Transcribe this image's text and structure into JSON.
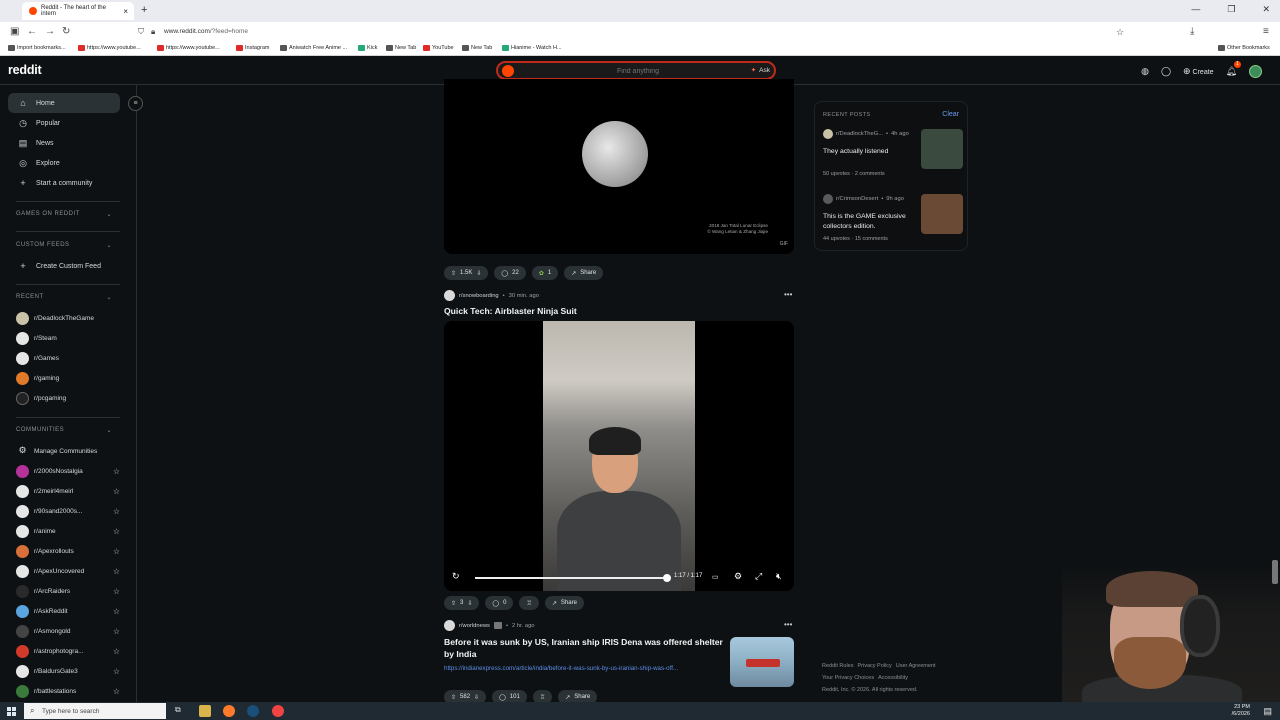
{
  "browser": {
    "tab_title": "Reddit - The heart of the intern",
    "tab_close": "×",
    "new_tab": "+",
    "url_host": "www.reddit.com",
    "url_path": "/?feed=home",
    "win_min": "—",
    "win_max": "❐",
    "win_close": "✕",
    "bookmarks": [
      "Import bookmarks...",
      "https://www.youtube...",
      "https://www.youtube...",
      "Instagram",
      "Aniwatch Free Anime ...",
      "Kick",
      "New Tab",
      "YouTube",
      "New Tab",
      "Hianime - Watch H..."
    ],
    "other_bookmarks": "Other Bookmarks"
  },
  "header": {
    "logo": "reddit",
    "search_placeholder": "Find anything",
    "ask_label": "Ask",
    "create_label": "Create",
    "notif_count": "1"
  },
  "sidebar": {
    "main": [
      {
        "label": "Home",
        "icon": "⌂"
      },
      {
        "label": "Popular",
        "icon": "◷"
      },
      {
        "label": "News",
        "icon": "▤"
      },
      {
        "label": "Explore",
        "icon": "◎"
      },
      {
        "label": "Start a community",
        "icon": "+"
      }
    ],
    "games_heading": "GAMES ON REDDIT",
    "custom_heading": "CUSTOM FEEDS",
    "create_custom_feed": "Create Custom Feed",
    "recent_heading": "RECENT",
    "recent": [
      {
        "name": "r/DeadlockTheGame",
        "color": "#c8c2a6"
      },
      {
        "name": "r/Steam",
        "color": "#e6e6e6"
      },
      {
        "name": "r/Games",
        "color": "#e6e6e6"
      },
      {
        "name": "r/gaming",
        "color": "#e07a2b"
      },
      {
        "name": "r/pcgaming",
        "color": "#222222"
      }
    ],
    "communities_heading": "COMMUNITIES",
    "manage_communities": "Manage Communities",
    "communities": [
      {
        "name": "r/2000sNostalgia",
        "color": "#b5329b"
      },
      {
        "name": "r/2meirl4meirl",
        "color": "#e6e6e6"
      },
      {
        "name": "r/90sand2000s...",
        "color": "#e6e6e6"
      },
      {
        "name": "r/anime",
        "color": "#e6e6e6"
      },
      {
        "name": "r/Apexrollouts",
        "color": "#d9703a"
      },
      {
        "name": "r/ApexUncovered",
        "color": "#e6e6e6"
      },
      {
        "name": "r/ArcRaiders",
        "color": "#2a2a2a"
      },
      {
        "name": "r/AskReddit",
        "color": "#5aa4e0"
      },
      {
        "name": "r/Asmongold",
        "color": "#444444"
      },
      {
        "name": "r/astrophotogra...",
        "color": "#d23a2a"
      },
      {
        "name": "r/BaldursGate3",
        "color": "#e6e6e6"
      },
      {
        "name": "r/battlestations",
        "color": "#3a7a3a"
      }
    ],
    "star": "☆",
    "chevron": "⌄"
  },
  "feed": {
    "post1": {
      "credit_line1": "2018 Jan Total Lunar Eclipse",
      "credit_line2": "© Wang Letian & Zhang Jiajie",
      "gif_label": "GIF",
      "upvotes": "1.5K",
      "comments": "22",
      "award": "1",
      "share": "Share"
    },
    "post2": {
      "subreddit": "r/snowboarding",
      "time": "30 min. ago",
      "title": "Quick Tech: Airblaster Ninja Suit",
      "video_time": "1:17 / 1:17",
      "progress_fraction": 1.0,
      "upvotes": "3",
      "comments": "0",
      "share": "Share"
    },
    "post3": {
      "subreddit": "r/worldnews",
      "time": "2 hr. ago",
      "title": "Before it was sunk by US, Iranian ship IRIS Dena was offered shelter by India",
      "link": "https://indianexpress.com/article/india/before-it-was-sunk-by-us-iranian-ship-was-off...",
      "upvotes": "582",
      "comments": "101",
      "share": "Share"
    }
  },
  "recent_posts": {
    "heading": "RECENT POSTS",
    "clear": "Clear",
    "items": [
      {
        "subreddit": "r/DeadlockTheG...",
        "time": "4h ago",
        "title": "They actually listened",
        "upvotes": "50 upvotes",
        "comments": "2 comments",
        "thumb_color": "#3b4a3e"
      },
      {
        "subreddit": "r/CrimsonDesert",
        "time": "9h ago",
        "title": "This is the GAME exclusive collectors edition.",
        "upvotes": "44 upvotes",
        "comments": "15 comments",
        "thumb_color": "#6a4a35"
      }
    ]
  },
  "footer": {
    "links": [
      "Reddit Rules",
      "Privacy Policy",
      "User Agreement",
      "Your Privacy Choices",
      "Accessibility"
    ],
    "copyright": "Reddit, Inc. © 2026. All rights reserved."
  },
  "taskbar": {
    "search": "Type here to search",
    "time": "23 PM",
    "date": "/6/2026"
  }
}
